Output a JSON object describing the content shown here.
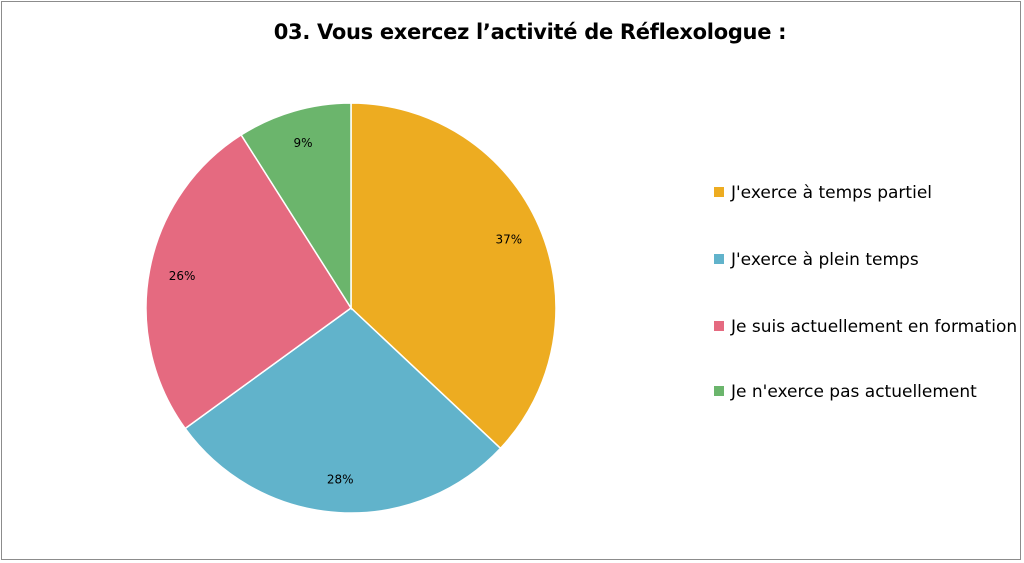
{
  "chart_data": {
    "type": "pie",
    "title": "03. Vous exercez l’activité de Réflexologue :",
    "categories": [
      "J'exerce à temps partiel",
      "J'exerce à plein temps",
      "Je suis actuellement en formation",
      "Je n'exerce pas actuellement"
    ],
    "values": [
      37,
      28,
      26,
      9
    ],
    "data_labels": [
      "37%",
      "28%",
      "26%",
      "9%"
    ],
    "colors": [
      "#EDAC21",
      "#61B3CB",
      "#E56A80",
      "#6BB56C"
    ],
    "legend_position": "right",
    "start_angle": "12 o'clock, clockwise"
  },
  "legend": {
    "items": [
      {
        "label": "J'exerce à temps partiel"
      },
      {
        "label": "J'exerce à plein temps"
      },
      {
        "label": "Je suis actuellement en formation"
      },
      {
        "label": "Je n'exerce pas actuellement"
      }
    ]
  }
}
